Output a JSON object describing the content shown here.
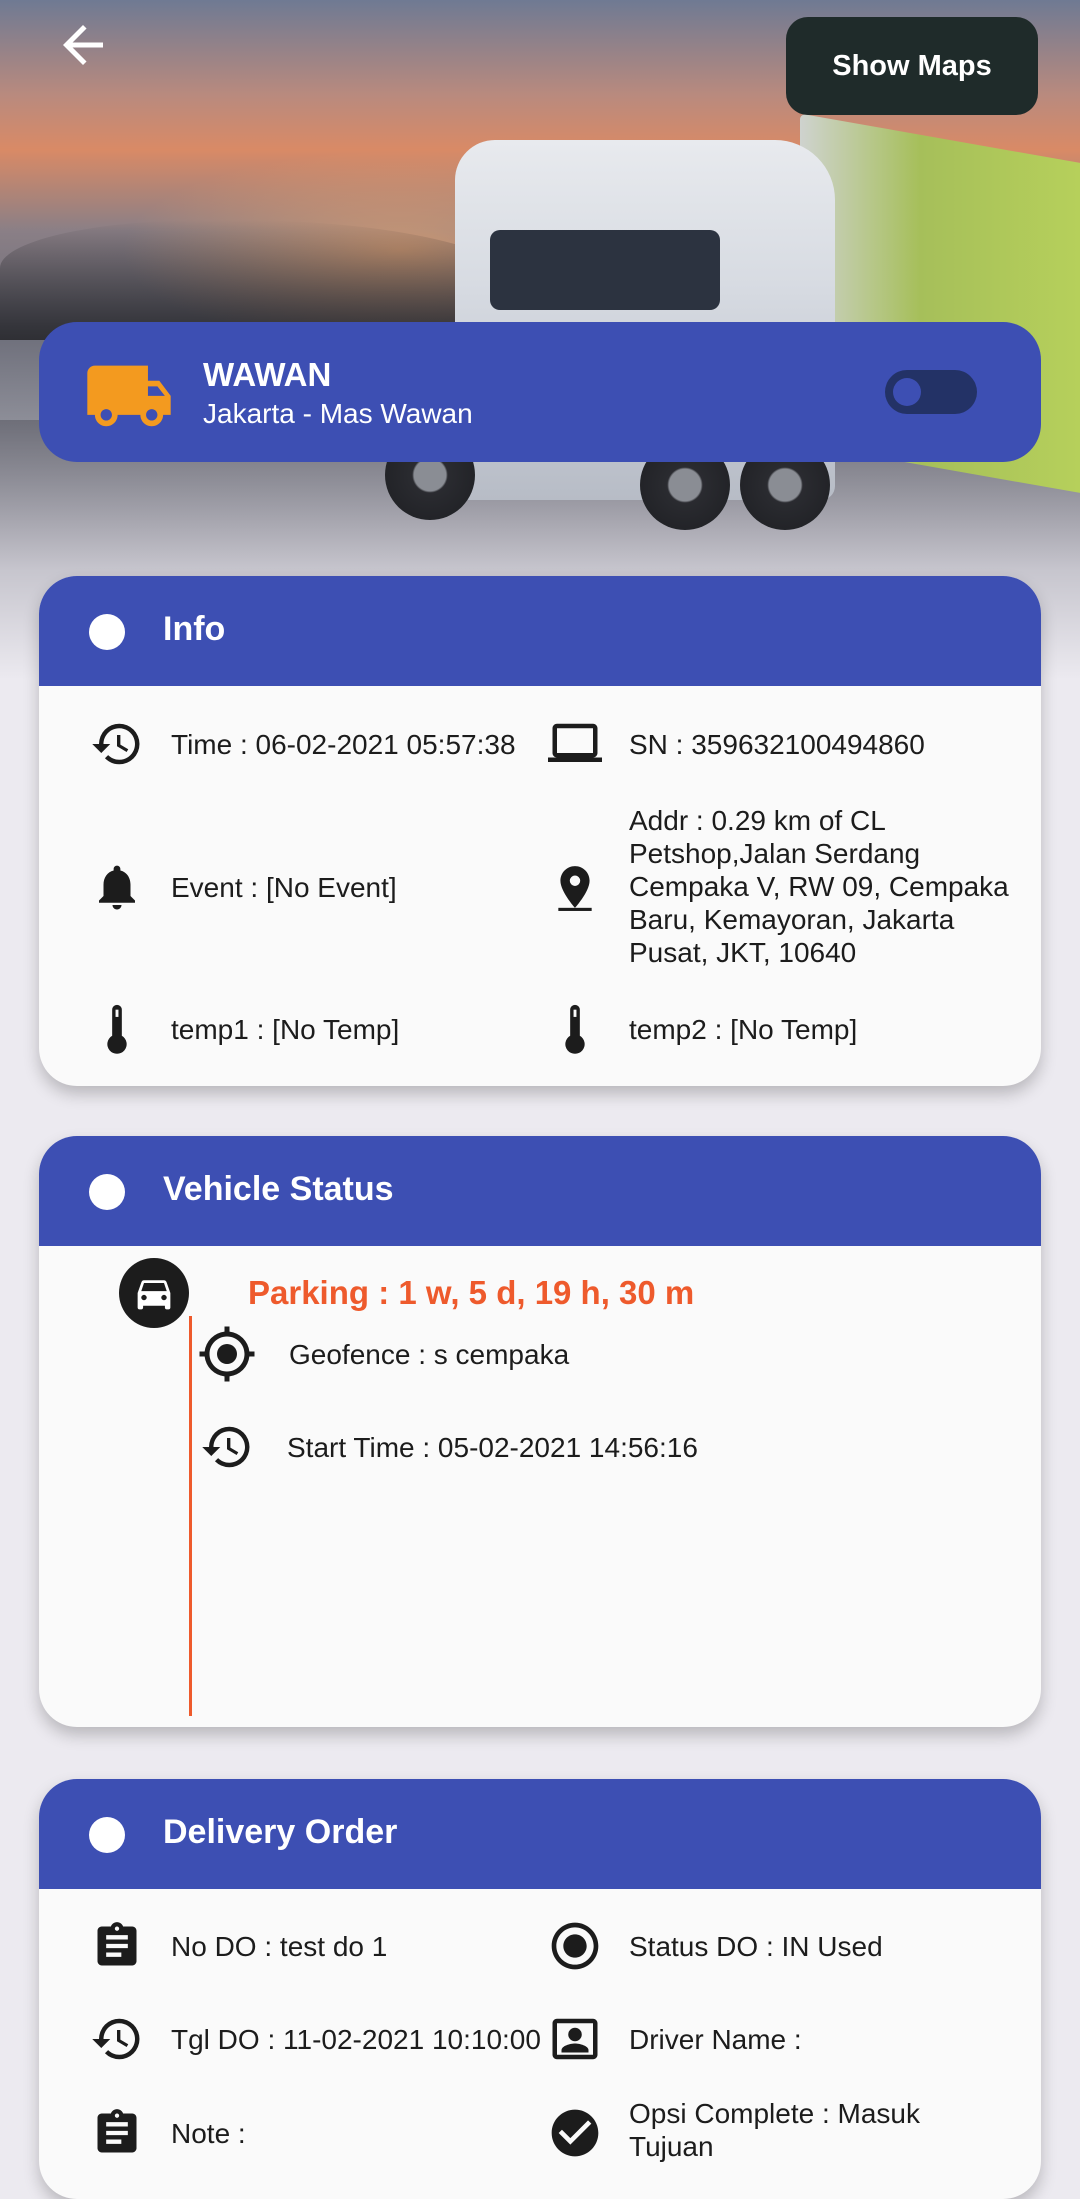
{
  "header": {
    "back_icon": "arrow-left-icon",
    "show_maps_label": "Show Maps"
  },
  "driver": {
    "icon": "truck-icon",
    "icon_color": "#f39a1f",
    "name": "WAWAN",
    "route": "Jakarta - Mas Wawan",
    "toggle_on": false
  },
  "info": {
    "title": "Info",
    "time": "Time : 06-02-2021 05:57:38",
    "sn": "SN : 359632100494860",
    "event": "Event : [No Event]",
    "addr": "Addr : 0.29 km of CL Petshop,Jalan Serdang Cempaka V, RW 09, Cempaka Baru, Kemayoran, Jakarta Pusat, JKT, 10640",
    "temp1": "temp1 : [No Temp]",
    "temp2": "temp2 : [No Temp]"
  },
  "vehicle_status": {
    "title": "Vehicle Status",
    "parking": "Parking : 1 w, 5 d, 19 h, 30 m",
    "geofence": "Geofence : s cempaka",
    "start_time": "Start Time : 05-02-2021 14:56:16"
  },
  "delivery_order": {
    "title": "Delivery Order",
    "no_do": "No DO : test do 1",
    "status_do": "Status DO : IN Used",
    "tgl_do": "Tgl DO : 11-02-2021 10:10:00",
    "driver_name": "Driver Name :",
    "note": "Note :",
    "opsi_complete": "Opsi Complete : Masuk Tujuan"
  },
  "colors": {
    "primary": "#3d4fb3",
    "accent": "#ee5a2c",
    "dark_button": "#1f2b2a"
  }
}
